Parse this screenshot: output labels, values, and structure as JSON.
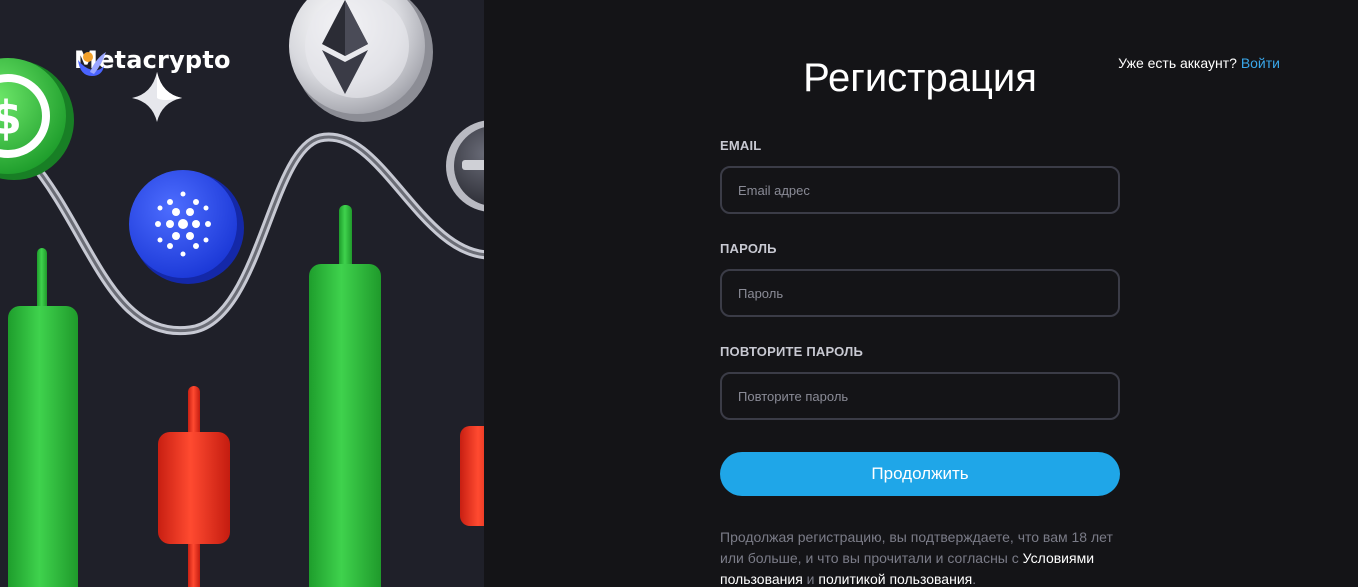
{
  "brand": {
    "name": "Metacrypto"
  },
  "header": {
    "have_account": "Уже есть аккаунт?",
    "login_link": "Войти"
  },
  "form": {
    "title": "Регистрация",
    "email": {
      "label": "EMAIL",
      "placeholder": "Email адрес"
    },
    "password": {
      "label": "ПАРОЛЬ",
      "placeholder": "Пароль"
    },
    "repeat_password": {
      "label": "ПОВТОРИТЕ ПАРОЛЬ",
      "placeholder": "Повторите пароль"
    },
    "continue_label": "Продолжить"
  },
  "terms": {
    "text_before": "Продолжая регистрацию, вы подтверждаете, что вам 18 лет или больше, и что вы прочитали и согласны с",
    "terms_link": "Условиями пользования",
    "and": "и",
    "policy_link": "политикой пользования",
    "end": "."
  },
  "colors": {
    "accent": "#1fa6e8",
    "link": "#3aa7ea",
    "candle_up": "#2bbf3a",
    "candle_down": "#e8321f"
  },
  "icons": [
    "metacrypto-logo-icon",
    "sparkle-star-icon",
    "usdc-coin-icon",
    "ethereum-coin-icon",
    "cardano-coin-icon",
    "dark-coin-icon"
  ]
}
